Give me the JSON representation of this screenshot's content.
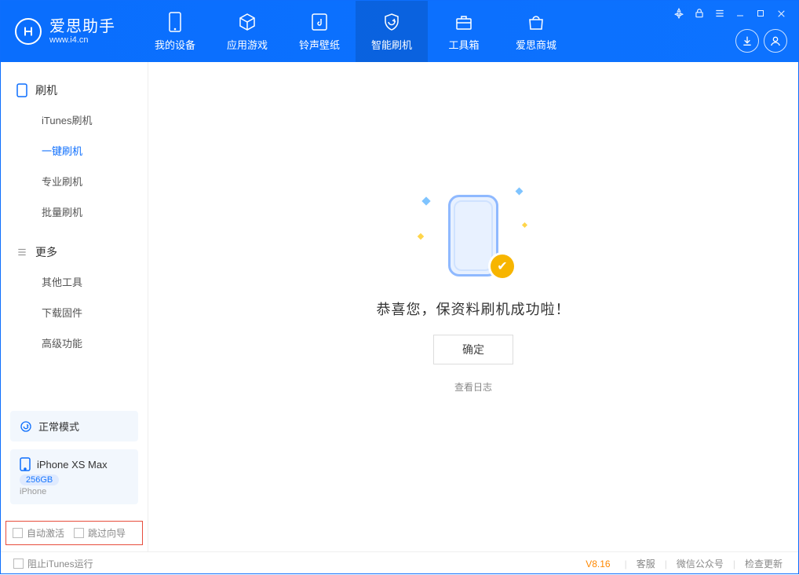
{
  "header": {
    "app_title": "爱思助手",
    "app_url": "www.i4.cn",
    "tabs": [
      {
        "label": "我的设备"
      },
      {
        "label": "应用游戏"
      },
      {
        "label": "铃声壁纸"
      },
      {
        "label": "智能刷机"
      },
      {
        "label": "工具箱"
      },
      {
        "label": "爱思商城"
      }
    ]
  },
  "sidebar": {
    "section1_title": "刷机",
    "items1": [
      {
        "label": "iTunes刷机"
      },
      {
        "label": "一键刷机"
      },
      {
        "label": "专业刷机"
      },
      {
        "label": "批量刷机"
      }
    ],
    "section2_title": "更多",
    "items2": [
      {
        "label": "其他工具"
      },
      {
        "label": "下载固件"
      },
      {
        "label": "高级功能"
      }
    ],
    "mode_label": "正常模式",
    "device_name": "iPhone XS Max",
    "device_storage": "256GB",
    "device_type": "iPhone",
    "auto_activate": "自动激活",
    "skip_guide": "跳过向导"
  },
  "main": {
    "success_text": "恭喜您，保资料刷机成功啦！",
    "ok_button": "确定",
    "view_log": "查看日志"
  },
  "footer": {
    "block_itunes": "阻止iTunes运行",
    "version": "V8.16",
    "links": [
      "客服",
      "微信公众号",
      "检查更新"
    ]
  }
}
